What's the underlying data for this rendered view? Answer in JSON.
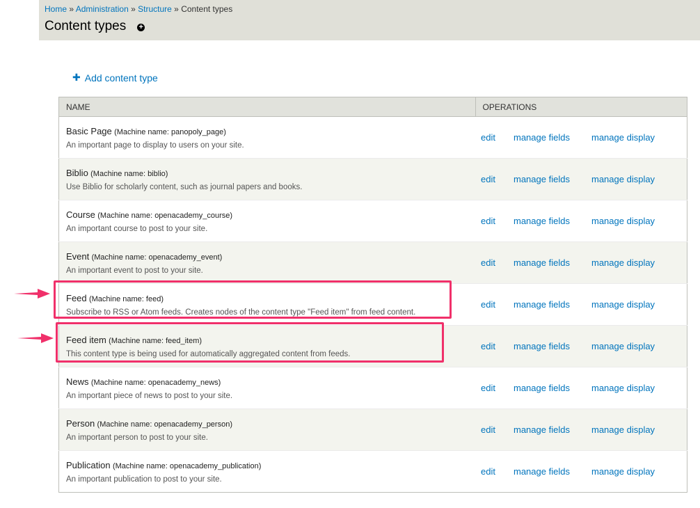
{
  "breadcrumb": {
    "home": "Home",
    "administration": "Administration",
    "structure": "Structure",
    "current": "Content types",
    "separator": "»"
  },
  "page": {
    "title": "Content types",
    "shortcut_icon": "add-shortcut-icon"
  },
  "actions": {
    "add_content_type": "Add content type",
    "add_icon": "plus-icon"
  },
  "table": {
    "headers": [
      "NAME",
      "OPERATIONS"
    ],
    "operations": {
      "edit": "edit",
      "manage_fields": "manage fields",
      "manage_display": "manage display"
    },
    "rows": [
      {
        "name": "Basic Page",
        "machine": "(Machine name: panopoly_page)",
        "description": "An important page to display to users on your site."
      },
      {
        "name": "Biblio",
        "machine": "(Machine name: biblio)",
        "description": "Use Biblio for scholarly content, such as journal papers and books."
      },
      {
        "name": "Course",
        "machine": "(Machine name: openacademy_course)",
        "description": "An important course to post to your site."
      },
      {
        "name": "Event",
        "machine": "(Machine name: openacademy_event)",
        "description": "An important event to post to your site."
      },
      {
        "name": "Feed",
        "machine": "(Machine name: feed)",
        "description": "Subscribe to RSS or Atom feeds. Creates nodes of the content type \"Feed item\" from feed content."
      },
      {
        "name": "Feed item",
        "machine": "(Machine name: feed_item)",
        "description": "This content type is being used for automatically aggregated content from feeds."
      },
      {
        "name": "News",
        "machine": "(Machine name: openacademy_news)",
        "description": "An important piece of news to post to your site."
      },
      {
        "name": "Person",
        "machine": "(Machine name: openacademy_person)",
        "description": "An important person to post to your site."
      },
      {
        "name": "Publication",
        "machine": "(Machine name: openacademy_publication)",
        "description": "An important publication to post to your site."
      }
    ]
  },
  "annotations": {
    "highlight_color": "#f0306a",
    "highlighted_rows": [
      "Feed",
      "Feed item"
    ]
  },
  "colors": {
    "link": "#0074bd",
    "header_bg": "#e0e0d8",
    "row_even": "#f3f4ee"
  }
}
